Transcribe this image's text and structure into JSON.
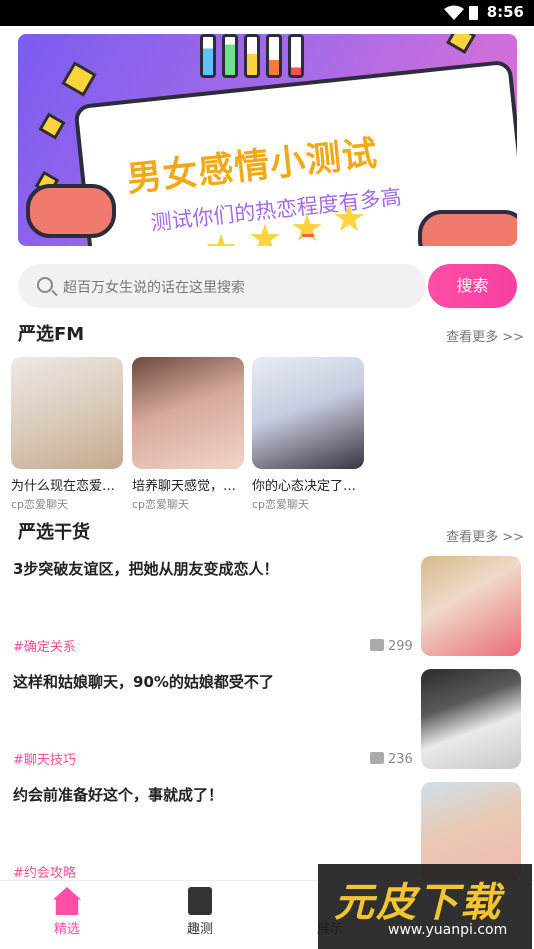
{
  "status_bar": {
    "time": "8:56"
  },
  "banner": {
    "title": "男女感情小测试",
    "subtitle": "测试你们的热恋程度有多高"
  },
  "search": {
    "placeholder": "超百万女生说的话在这里搜索",
    "button_label": "搜索"
  },
  "fm_section": {
    "title": "严选FM",
    "more_label": "查看更多 >>",
    "items": [
      {
        "title": "为什么现在恋爱…",
        "source": "cp恋爱聊天",
        "image": "photo-woman-white-dress"
      },
      {
        "title": "培养聊天感觉，…",
        "source": "cp恋爱聊天",
        "image": "photo-woman-flowers"
      },
      {
        "title": "你的心态决定了…",
        "source": "cp恋爱聊天",
        "image": "photo-woman-white-top"
      }
    ]
  },
  "articles_section": {
    "title": "严选干货",
    "more_label": "查看更多 >>",
    "items": [
      {
        "title": "3步突破友谊区，把她从朋友变成恋人！",
        "tag": "#确定关系",
        "likes": "299",
        "image": "photo-girl-straw-hat"
      },
      {
        "title": "这样和姑娘聊天，90%的姑娘都受不了",
        "tag": "#聊天技巧",
        "likes": "236",
        "image": "photo-girl-school-uniform"
      },
      {
        "title": "约会前准备好这个，事就成了！",
        "tag": "#约会攻略",
        "likes": "",
        "image": "photo-girl-sun-hat"
      }
    ]
  },
  "tab_bar": {
    "tabs": [
      {
        "label": "精选",
        "icon": "home-icon",
        "active": true
      },
      {
        "label": "趣测",
        "icon": "note-icon",
        "active": false
      },
      {
        "label": "展示",
        "icon": "chart-icon",
        "active": false
      }
    ]
  },
  "watermark": {
    "brand": "元皮下载",
    "url": "www.yuanpi.com"
  },
  "colors": {
    "accent": "#ff4fa6",
    "tag": "#ee4f9a",
    "banner_start": "#7a5cf0",
    "banner_end": "#e772d3"
  }
}
